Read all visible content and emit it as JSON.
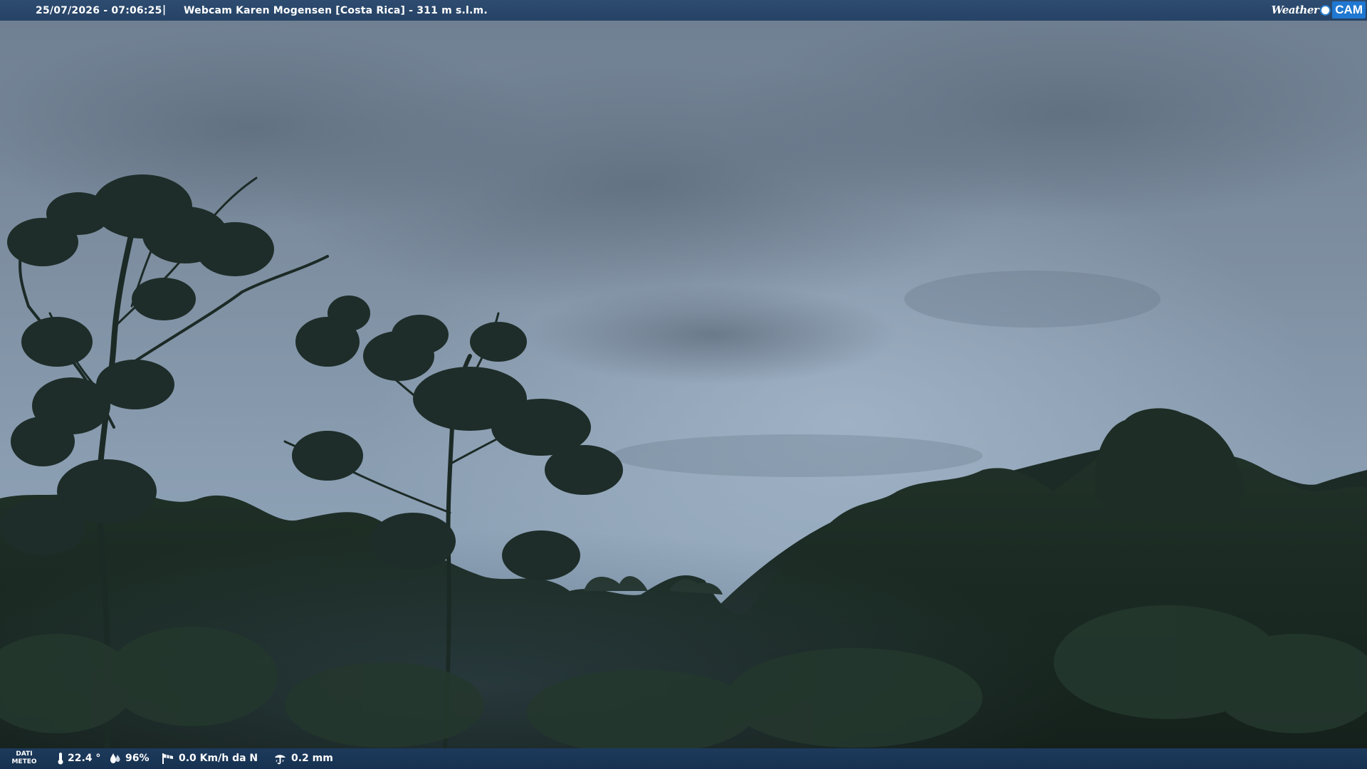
{
  "top_bar": {
    "date_time": "25/07/2026 - 07:06:25",
    "separator": "|",
    "title": "Webcam Karen Mogensen [Costa Rica]  - 311 m s.l.m."
  },
  "logo": {
    "weather": "Weather",
    "cam": "CAM"
  },
  "bottom_bar": {
    "meteo_label_line1": "DATI",
    "meteo_label_line2": "METEO",
    "temperature": "22.4 °",
    "humidity": "96%",
    "wind": "0.0 Km/h da N",
    "rain": "0.2 mm"
  },
  "icons": {
    "temperature": "thermometer-icon",
    "humidity": "drop-icon",
    "wind": "windsock-icon",
    "rain": "rain-gauge-icon"
  },
  "colors": {
    "top_bar": "#2e4c70",
    "bottom_bar": "#1d3a5c",
    "sky": "#8a9aaa",
    "foliage": "#1a2a22",
    "logo_accent": "#1f78d1"
  }
}
